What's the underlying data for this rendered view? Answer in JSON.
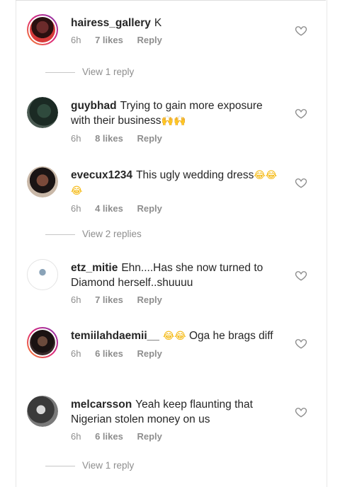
{
  "comments": [
    {
      "user": "hairess_gallery",
      "text": "K",
      "time": "6h",
      "likes": "7 likes",
      "reply": "Reply"
    },
    {
      "user": "guybhad",
      "text": "Trying to gain more exposure with their business",
      "emoji": "🙌🙌",
      "time": "6h",
      "likes": "8 likes",
      "reply": "Reply"
    },
    {
      "user": "evecux1234",
      "text": "This ugly wedding dress",
      "emoji": "😂😂😂",
      "time": "6h",
      "likes": "4 likes",
      "reply": "Reply"
    },
    {
      "user": "etz_mitie",
      "text": "Ehn....Has she now turned to Diamond herself..shuuuu",
      "time": "6h",
      "likes": "7 likes",
      "reply": "Reply"
    },
    {
      "user": "temiilahdaemii__",
      "emoji": "😂😂",
      "text": "Oga he brags diff",
      "time": "6h",
      "likes": "6 likes",
      "reply": "Reply"
    },
    {
      "user": "melcarsson",
      "text": "Yeah keep flaunting that Nigerian stolen money on us",
      "time": "6h",
      "likes": "6 likes",
      "reply": "Reply"
    }
  ],
  "view_replies": [
    "View 1 reply",
    "View 2 replies",
    "View 1 reply"
  ],
  "icons": {
    "like": "heart-outline-icon"
  },
  "colors": {
    "meta": "#8e8e8e",
    "text": "#262626",
    "story_ring": "#dd2a7b"
  }
}
